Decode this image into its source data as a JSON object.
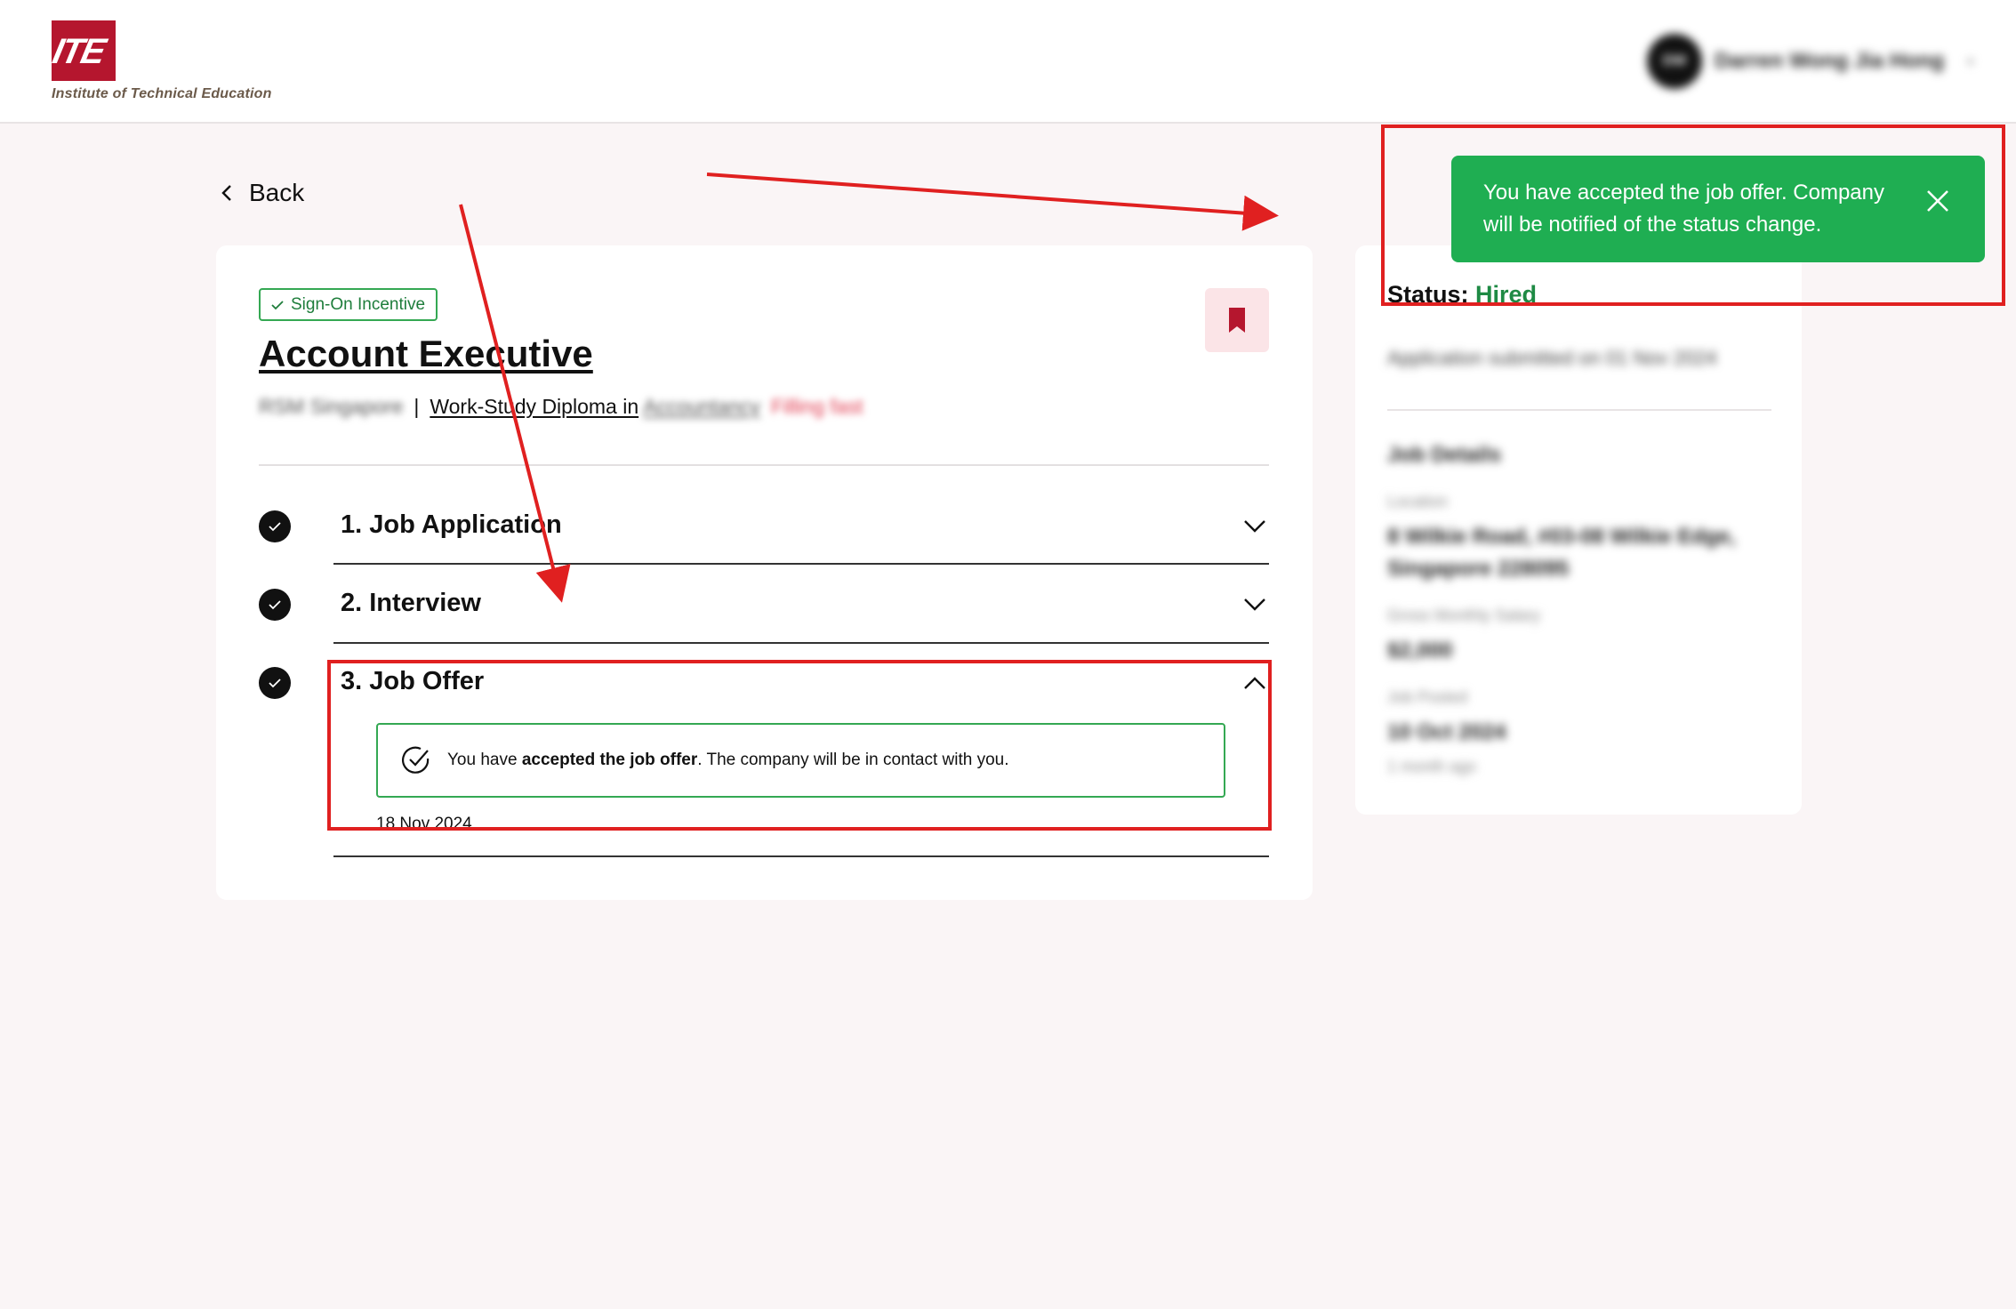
{
  "header": {
    "logo_mark": "ITE",
    "logo_text": "Institute of Technical Education",
    "user_initials": "DW",
    "user_name": "Darren Wong Jia Hong"
  },
  "nav": {
    "back_label": "Back"
  },
  "job": {
    "badge": "Sign-On Incentive",
    "title": "Account Executive",
    "company": "RSM Singapore",
    "separator": "|",
    "program_prefix": "Work-Study Diploma in",
    "program_field": "Accountancy",
    "status_note": "Filling fast"
  },
  "steps": [
    {
      "label": "1. Job Application"
    },
    {
      "label": "2. Interview"
    },
    {
      "label": "3. Job Offer"
    }
  ],
  "offer": {
    "text_before": "You have ",
    "text_bold": "accepted the job offer",
    "text_after": ". The company will be in contact with you.",
    "date": "18 Nov 2024"
  },
  "side": {
    "status_label": "Status:",
    "status_value": "Hired",
    "submitted": "Application submitted on 01 Nov 2024",
    "details_heading": "Job Details",
    "location_label": "Location",
    "location_line1": "8 Wilkie Road, #03-08 Wilkie Edge,",
    "location_line2": "Singapore 228095",
    "salary_label": "Gross Monthly Salary",
    "salary_value": "$2,000",
    "posted_label": "Job Posted",
    "posted_value": "10 Oct 2024",
    "posted_ago": "1 month ago"
  },
  "toast": {
    "message": "You have accepted the job offer. Company will be notified of the status change."
  },
  "colors": {
    "brand": "#b5162e",
    "success": "#1fae52",
    "annotation": "#e02020"
  }
}
